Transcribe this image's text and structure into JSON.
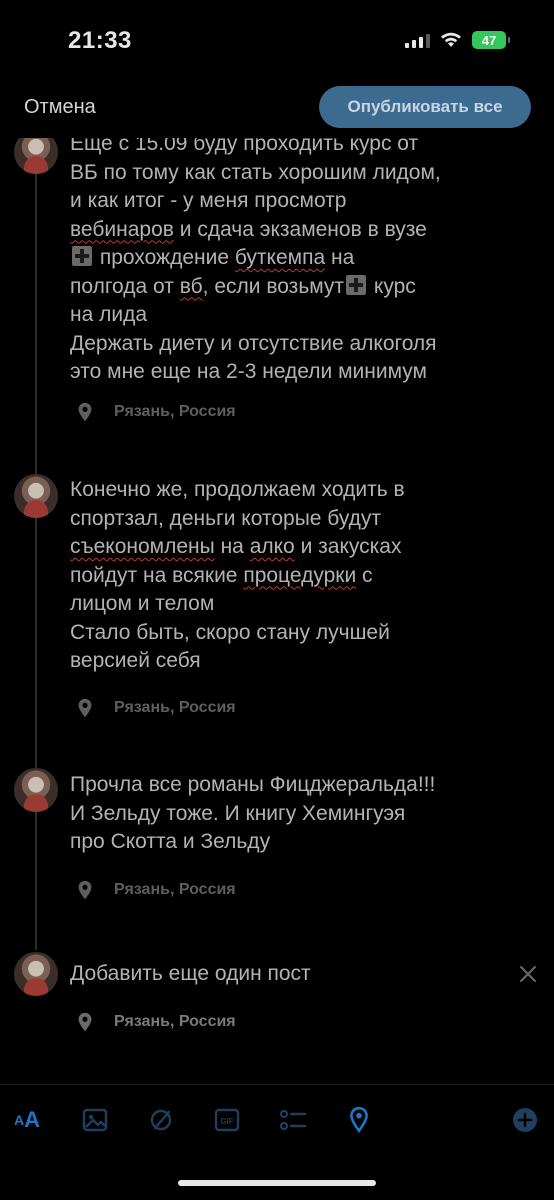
{
  "status_bar": {
    "time": "21:33",
    "battery": "47"
  },
  "header": {
    "cancel_label": "Отмена",
    "publish_label": "Опубликовать все"
  },
  "posts": [
    {
      "text_segments": [
        "Еще с 15.09 буду проходить курс от\nВБ по тому как стать хорошим лидом,\nи как итог - у меня просмотр\n",
        "вебинаров",
        " и сдача экзаменов в вузе\n",
        " прохождение ",
        "буткемпа",
        " на\nполгода от ",
        "вб",
        ", если возьмут",
        " курс\nна лида\nДержать диету и отсутствие алкоголя\nэто мне еще на 2-3 недели минимум"
      ],
      "location": "Рязань, Россия"
    },
    {
      "text_segments": [
        "Конечно же, продолжаем ходить в\nспортзал, деньги которые будут\n",
        "съекономлены",
        " на ",
        "алко",
        " и закусках\nпойдут на всякие ",
        "процедурки",
        " с\nлицом и телом\nСтало быть, скоро стану лучшей\nверсией себя"
      ],
      "location": "Рязань, Россия"
    },
    {
      "text": "Прочла все романы Фицджеральда!!!\nИ Зельду тоже. И книгу Хемингуэя\nпро Скотта и Зельду",
      "location": "Рязань, Россия"
    }
  ],
  "new_post": {
    "placeholder": "Добавить еще один пост",
    "location": "Рязань, Россия"
  },
  "toolbar": {
    "text_size_label_small": "A",
    "text_size_label_big": "A",
    "icons": [
      "text-size-icon",
      "image-icon",
      "circle-slash-icon",
      "gif-icon",
      "list-icon",
      "location-icon",
      "add-icon"
    ],
    "gif_label": "GIF",
    "accent": "#1d76c9"
  },
  "colors": {
    "background": "#000000",
    "publish_button": "#3d6a8f",
    "text": "#b3b3b3",
    "muted": "#5e5e5e"
  }
}
